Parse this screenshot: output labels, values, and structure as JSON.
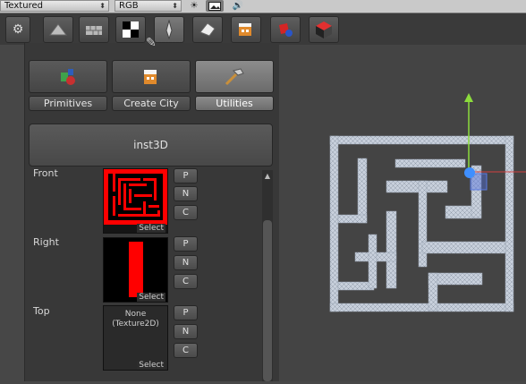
{
  "topbar": {
    "shading_mode": "Textured",
    "render_mode": "RGB",
    "icons": [
      "sun-icon",
      "image-icon",
      "speaker-icon"
    ]
  },
  "toolbar": {
    "buttons": [
      "gear-icon",
      "pyramid-icon",
      "wall-icon",
      "checker-icon",
      "pen-icon",
      "eraser-icon",
      "building-icon",
      "shapes-icon",
      "cube-icon"
    ]
  },
  "panel": {
    "tabs": [
      {
        "label": "Primitives",
        "icon": "primitives-icon",
        "selected": false
      },
      {
        "label": "Create City",
        "icon": "city-icon",
        "selected": false
      },
      {
        "label": "Utilities",
        "icon": "hammer-icon",
        "selected": true
      }
    ],
    "inst_button": "inst3D",
    "views": [
      {
        "label": "Front",
        "texture": "maze-red",
        "select": "Select",
        "buttons": [
          "P",
          "N",
          "C"
        ]
      },
      {
        "label": "Right",
        "texture": "bar-red",
        "select": "Select",
        "buttons": [
          "P",
          "N",
          "C"
        ]
      },
      {
        "label": "Top",
        "texture": "none",
        "none_text": "None (Texture2D)",
        "select": "Select",
        "buttons": [
          "P",
          "N",
          "C"
        ]
      }
    ]
  },
  "colors": {
    "accent_red": "#ff0000",
    "gizmo_green": "#8cdc3c",
    "gizmo_blue": "#3f8fff",
    "maze_light": "#c8d0dc"
  }
}
